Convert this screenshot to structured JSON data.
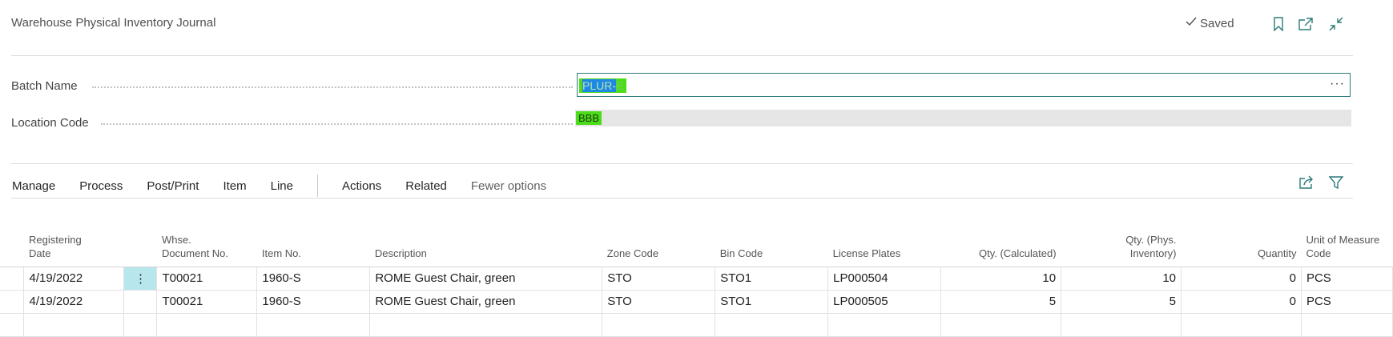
{
  "header": {
    "title": "Warehouse Physical Inventory Journal",
    "saved_label": "Saved"
  },
  "fields": {
    "batch_name_label": "Batch Name",
    "batch_name_value_selected": "PLUR-",
    "batch_name_value_rest": "E",
    "batch_more": "···",
    "location_code_label": "Location Code",
    "location_code_value": "BBB"
  },
  "menu": {
    "items": [
      "Manage",
      "Process",
      "Post/Print",
      "Item",
      "Line"
    ],
    "items2": [
      "Actions",
      "Related"
    ],
    "fewer_options": "Fewer options"
  },
  "table": {
    "headers": {
      "registering_date_1": "Registering",
      "registering_date_2": "Date",
      "whse_doc_1": "Whse.",
      "whse_doc_2": "Document No.",
      "item_no": "Item No.",
      "description": "Description",
      "zone_code": "Zone Code",
      "bin_code": "Bin Code",
      "license_plates": "License Plates",
      "qty_calculated": "Qty. (Calculated)",
      "qty_phys_1": "Qty. (Phys.",
      "qty_phys_2": "Inventory)",
      "quantity": "Quantity",
      "uom_1": "Unit of Measure",
      "uom_2": "Code"
    },
    "row_menu_icon": "⋮",
    "rows": [
      {
        "date": "4/19/2022",
        "doc": "T00021",
        "item": "1960-S",
        "desc": "ROME Guest Chair, green",
        "zone": "STO",
        "bin": "STO1",
        "lp": "LP000504",
        "qty_calc": "10",
        "qty_phys": "10",
        "qty": "0",
        "uom": "PCS"
      },
      {
        "date": "4/19/2022",
        "doc": "T00021",
        "item": "1960-S",
        "desc": "ROME Guest Chair, green",
        "zone": "STO",
        "bin": "STO1",
        "lp": "LP000505",
        "qty_calc": "5",
        "qty_phys": "5",
        "qty": "0",
        "uom": "PCS"
      }
    ]
  },
  "colors": {
    "accent": "#2b7a78",
    "highlight_green": "#4ddc1a",
    "selection_blue": "#1e88e5",
    "row_menu_bg": "#b7e6ec"
  }
}
